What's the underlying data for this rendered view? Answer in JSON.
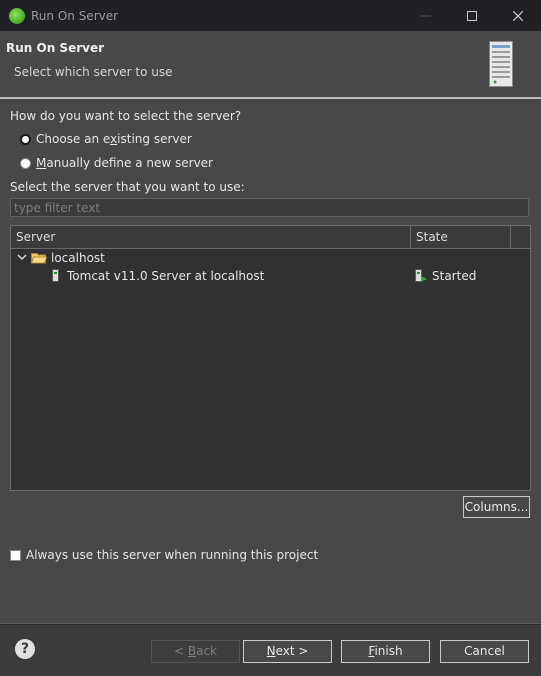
{
  "window": {
    "title": "Run On Server"
  },
  "header": {
    "title": "Run On Server",
    "subtitle": "Select which server to use"
  },
  "question": "How do you want to select the server?",
  "radios": [
    {
      "label_pre": "Choose an e",
      "accel": "x",
      "label_post": "isting server",
      "checked": true
    },
    {
      "label_pre": "",
      "accel": "M",
      "label_post": "anually define a new server",
      "checked": false
    }
  ],
  "select_label": "Select the server that you want to use:",
  "filter": {
    "placeholder": "type filter text",
    "value": ""
  },
  "table": {
    "columns": [
      "Server",
      "State"
    ],
    "rows": [
      {
        "name": "localhost",
        "type": "host"
      },
      {
        "name": "Tomcat v11.0 Server at localhost",
        "state": "Started",
        "type": "server"
      }
    ]
  },
  "columns_button": "Columns...",
  "always_use": {
    "label": "Always use this server when running this project",
    "checked": false
  },
  "buttons": {
    "back": {
      "pre": "< ",
      "accel": "B",
      "post": "ack"
    },
    "next": {
      "pre": "",
      "accel": "N",
      "post": "ext >"
    },
    "finish": {
      "pre": "",
      "accel": "F",
      "post": "inish"
    },
    "cancel": "Cancel"
  },
  "colors": {
    "background": "#47484a",
    "titlebar": "#202124",
    "table_bg": "#303133",
    "accent_green": "#4fae2c"
  }
}
